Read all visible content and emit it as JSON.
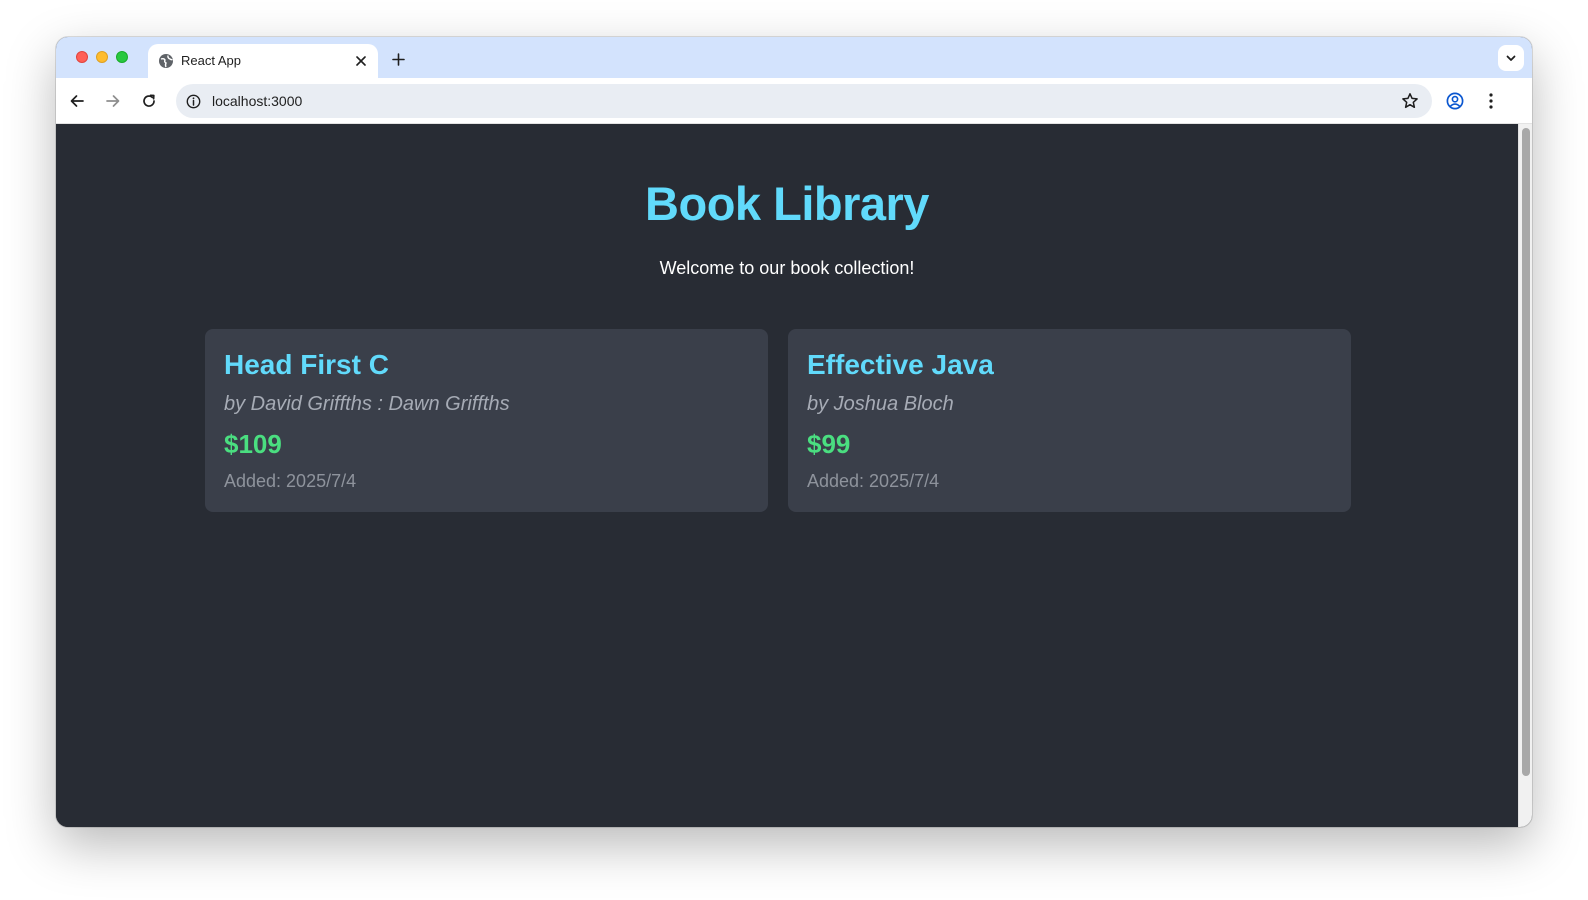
{
  "browser": {
    "tab_title": "React App",
    "url": "localhost:3000"
  },
  "icons": {
    "favicon": "globe-icon",
    "tab_close": "close-icon",
    "new_tab": "plus-icon",
    "tab_search": "chevron-down-icon",
    "back": "arrow-left-icon",
    "forward": "arrow-right-icon",
    "reload": "reload-icon",
    "site_info": "info-icon",
    "bookmark": "star-icon",
    "profile": "profile-icon",
    "menu": "kebab-menu-icon"
  },
  "colors": {
    "page_bg": "#282c34",
    "accent": "#61dafb",
    "price": "#4ade80",
    "card_bg": "#3a3f4a"
  },
  "page": {
    "title": "Book Library",
    "subtitle": "Welcome to our book collection!"
  },
  "books": [
    {
      "title": "Head First C",
      "author": "by David Griffths : Dawn Griffths",
      "price": "$109",
      "added": "Added: 2025/7/4"
    },
    {
      "title": "Effective Java",
      "author": "by Joshua Bloch",
      "price": "$99",
      "added": "Added: 2025/7/4"
    }
  ]
}
